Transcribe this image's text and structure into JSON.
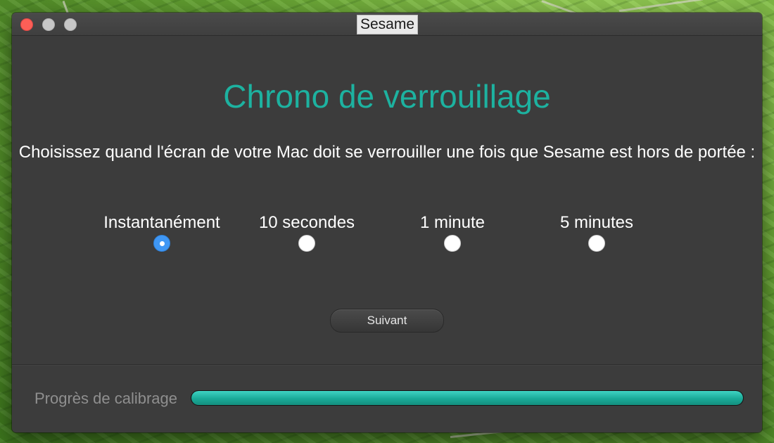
{
  "window": {
    "title": "Sesame"
  },
  "main": {
    "heading": "Chrono de verrouillage",
    "description": "Choisissez quand l'écran de votre Mac doit se verrouiller une fois que Sesame est hors de portée :",
    "options": [
      {
        "label": "Instantanément",
        "selected": true
      },
      {
        "label": "10 secondes",
        "selected": false
      },
      {
        "label": "1 minute",
        "selected": false
      },
      {
        "label": "5 minutes",
        "selected": false
      }
    ],
    "next_label": "Suivant"
  },
  "footer": {
    "progress_label": "Progrès de calibrage",
    "progress_fraction": 1.0
  },
  "colors": {
    "heading": "#1db2a0",
    "progress": "#1db2a0",
    "radio_selected": "#3f97f4",
    "window_bg": "#3c3c3c"
  }
}
